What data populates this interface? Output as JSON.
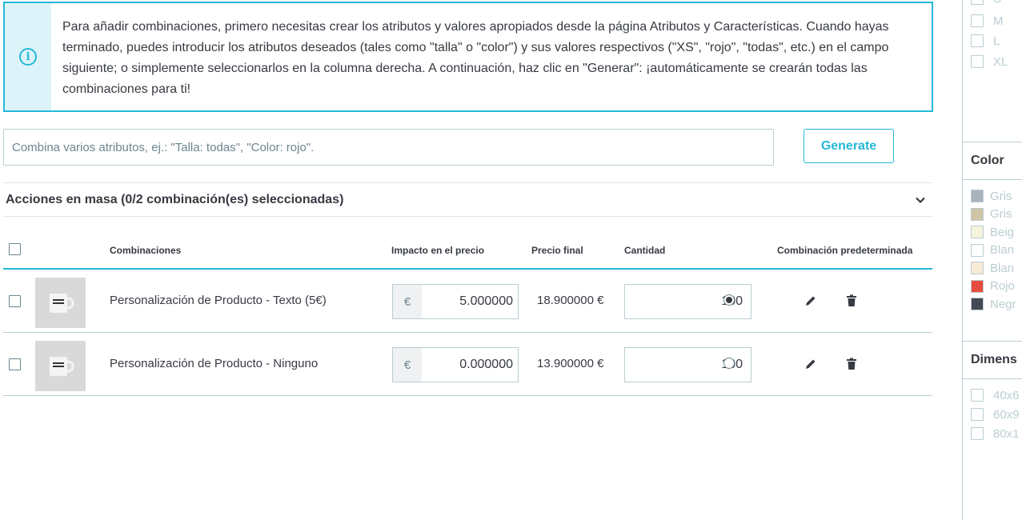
{
  "alert": {
    "icon": "info-icon",
    "text": "Para añadir combinaciones, primero necesitas crear los atributos y valores apropiados desde la página Atributos y Características. Cuando hayas terminado, puedes introducir los atributos deseados (tales como \"talla\" o \"color\") y sus valores respectivos (\"XS\", \"rojo\", \"todas\", etc.) en el campo siguiente; o simplemente seleccionarlos en la columna derecha. A continuación, haz clic en \"Generar\": ¡automáticamente se crearán todas las combinaciones para ti!"
  },
  "generator": {
    "placeholder": "Combina varios atributos, ej.: \"Talla: todas\", \"Color: rojo\".",
    "button_label": "Generate"
  },
  "bulk": {
    "title": "Acciones en masa (0/2 combinación(es) seleccionadas)"
  },
  "table": {
    "headers": {
      "combinations": "Combinaciones",
      "price_impact": "Impacto en el precio",
      "final_price": "Precio final",
      "quantity": "Cantidad",
      "default": "Combinación predeterminada"
    },
    "rows": [
      {
        "name": "Personalización de Producto - Texto (5€)",
        "currency": "€",
        "price_impact": "5.000000",
        "final_price": "18.900000 €",
        "quantity": "100",
        "default": true
      },
      {
        "name": "Personalización de Producto - Ninguno",
        "currency": "€",
        "price_impact": "0.000000",
        "final_price": "13.900000 €",
        "quantity": "100",
        "default": false
      }
    ]
  },
  "sidebar": {
    "sizes": [
      "S",
      "M",
      "L",
      "XL"
    ],
    "color_heading": "Color",
    "colors": [
      {
        "label": "Gris",
        "hex": "#aab2bd"
      },
      {
        "label": "Gris",
        "hex": "#cfc4a6"
      },
      {
        "label": "Beig",
        "hex": "#f5f5dc"
      },
      {
        "label": "Blan",
        "hex": "#ffffff"
      },
      {
        "label": "Blan",
        "hex": "#faebd7"
      },
      {
        "label": "Rojo",
        "hex": "#e84c3d"
      },
      {
        "label": "Negr",
        "hex": "#434a54"
      }
    ],
    "dimension_heading": "Dimens",
    "dimensions": [
      "40x6",
      "60x9",
      "80x1"
    ]
  },
  "colors": {
    "accent": "#25b9d7",
    "text": "#363a41",
    "muted": "#6c868e",
    "border": "#bbcdd2"
  }
}
